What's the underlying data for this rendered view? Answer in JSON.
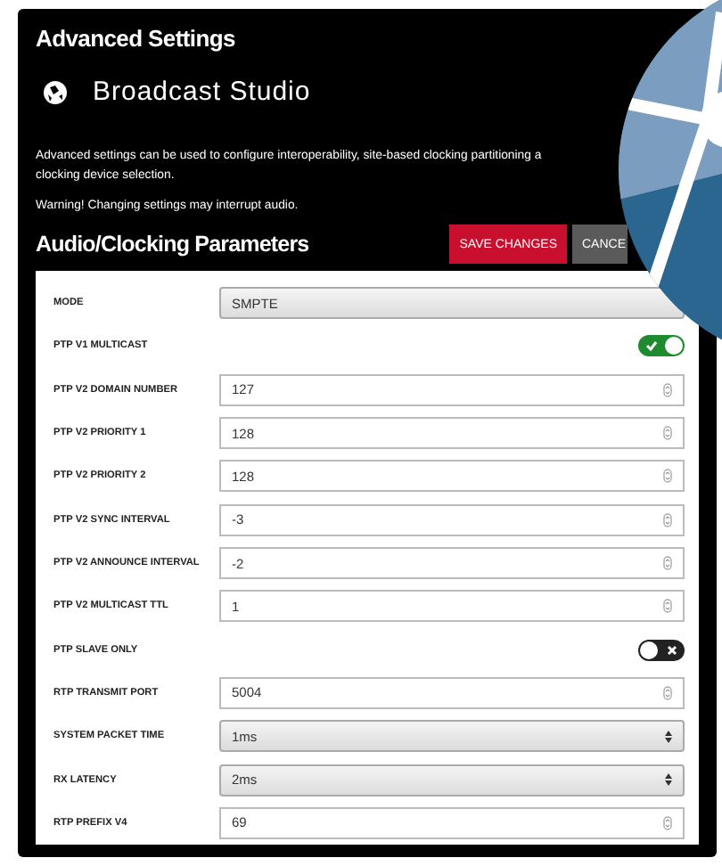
{
  "panel": {
    "title": "Advanced Settings",
    "device": "Broadcast Studio",
    "description": "Advanced settings can be used to configure interoperability, site-based clocking partitioning a",
    "description_2": "clocking device selection.",
    "warning": "Warning! Changing settings may interrupt audio."
  },
  "section": {
    "title": "Audio/Clocking Parameters",
    "buttons": [
      {
        "label": "SAVE CHANGES",
        "kind": "primary"
      },
      {
        "label": "CANCE",
        "kind": "secondary"
      }
    ]
  },
  "fields": [
    {
      "label": "MODE",
      "kind": "readonly",
      "value": "SMPTE"
    },
    {
      "label": "PTP V1 MULTICAST",
      "kind": "toggle",
      "on": true
    },
    {
      "label": "PTP V2 DOMAIN NUMBER",
      "kind": "number",
      "value": "127"
    },
    {
      "label": "PTP V2 PRIORITY 1",
      "kind": "number",
      "value": "128"
    },
    {
      "label": "PTP V2 PRIORITY 2",
      "kind": "number",
      "value": "128"
    },
    {
      "label": "PTP V2 SYNC INTERVAL",
      "kind": "number",
      "value": "-3"
    },
    {
      "label": "PTP V2 ANNOUNCE INTERVAL",
      "kind": "number",
      "value": "-2"
    },
    {
      "label": "PTP V2 MULTICAST TTL",
      "kind": "number",
      "value": "1"
    },
    {
      "label": "PTP SLAVE ONLY",
      "kind": "toggle",
      "on": false
    },
    {
      "label": "RTP TRANSMIT PORT",
      "kind": "number",
      "value": "5004"
    },
    {
      "label": "SYSTEM PACKET TIME",
      "kind": "select",
      "value": "1ms"
    },
    {
      "label": "RX LATENCY",
      "kind": "select",
      "value": "2ms"
    },
    {
      "label": "RTP PREFIX V4",
      "kind": "number",
      "value": "69"
    }
  ]
}
